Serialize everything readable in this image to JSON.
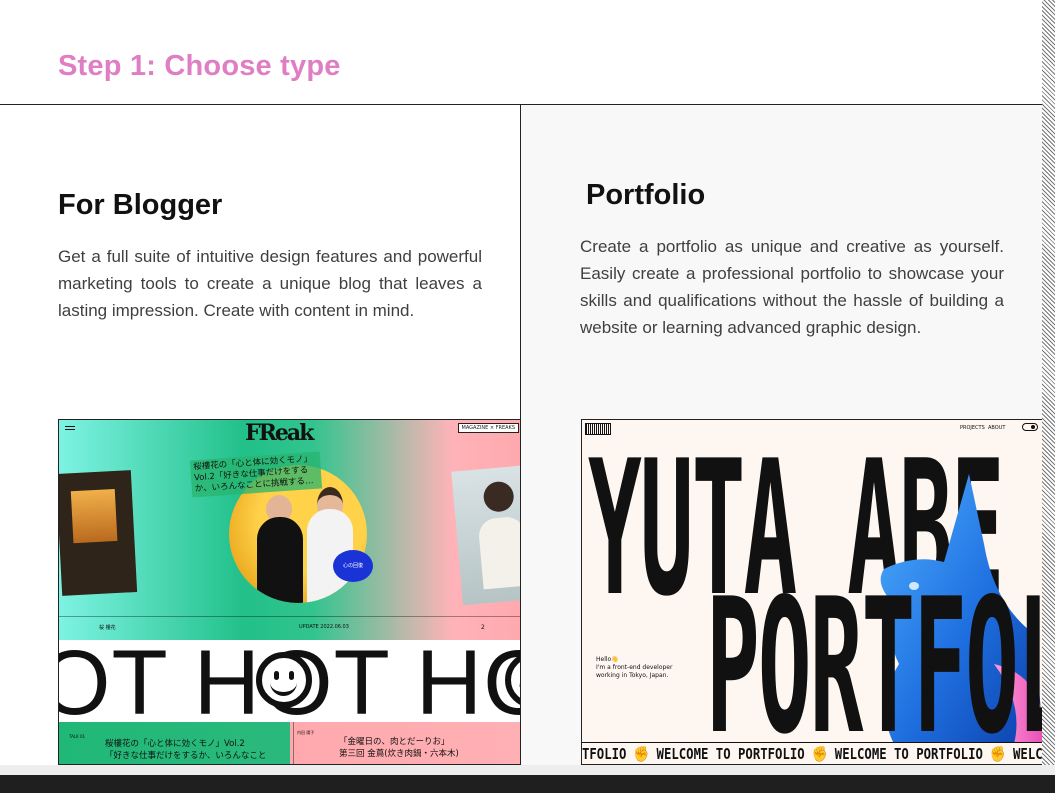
{
  "page": {
    "step_title": "Step 1: Choose type"
  },
  "cards": {
    "blogger": {
      "title": "For Blogger",
      "description": "Get a full suite of intuitive design features and powerful marketing tools to create a unique blog that leaves a lasting impression. Create with content in mind.",
      "preview": {
        "logo": "FReak",
        "nav": "MAGAZINE × FREAKS",
        "caption": "桜樓花の「心と体に効くモノ」Vol.2「好きな仕事だけをするか、いろんなことに挑戦する…",
        "sticker": "心の回復",
        "meta_author": "桜 樓花",
        "meta_update": "UPDATE 2022.06.03",
        "meta_count": "2",
        "hot_text": "OT HOT HO",
        "bottom_left": "桜樓花の「心と体に効くモノ」Vol.2\n「好きな仕事だけをするか、いろんなこと",
        "bottom_right": "「金曜日の、肉とだーりお」\n第三回 金蔦(炊き肉鍋・六本木)",
        "bottom_tag_left": "TALK 01",
        "bottom_tag_right": "内田 陽子"
      }
    },
    "portfolio": {
      "title": "Portfolio",
      "description": "Create a portfolio as unique and creative as yourself. Easily create a professional portfolio to showcase your skills and qualifications without the hassle of building a website or learning advanced graphic design.",
      "preview": {
        "nav_projects": "PROJECTS",
        "nav_about": "ABOUT",
        "headline_1": "YUTA ABE",
        "headline_2": "PORTFOLIO",
        "hello": "Hello👋\nI'm a front-end developer\nworking in Tokyo, Japan.",
        "ticker": "TFOLIO ✊ WELCOME TO PORTFOLIO ✊ WELCOME TO PORTFOLIO ✊ WELCOME TO PORTFOLIO"
      }
    }
  },
  "colors": {
    "accent": "#e07ec4",
    "panel_bg": "#f8f8f8",
    "blog_green": "#22c08a",
    "blog_pink": "#ffa9ae",
    "portfolio_blue": "#1f6fe0"
  }
}
